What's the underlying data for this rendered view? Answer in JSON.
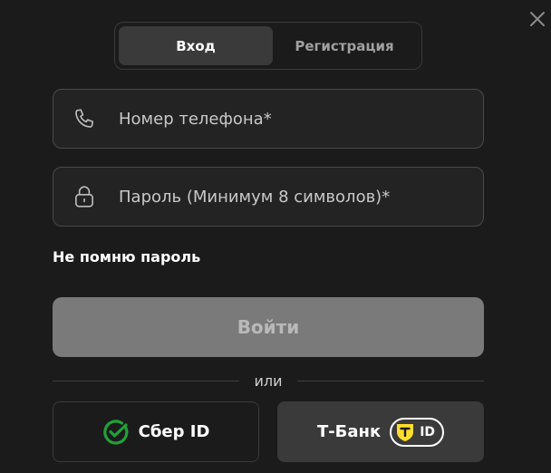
{
  "tabs": [
    {
      "label": "Вход",
      "active": true
    },
    {
      "label": "Регистрация",
      "active": false
    }
  ],
  "phone": {
    "placeholder": "Номер телефона*",
    "value": "",
    "icon": "phone-icon"
  },
  "password": {
    "placeholder": "Пароль (Минимум 8 символов)*",
    "value": "",
    "icon": "lock-icon"
  },
  "forgot_label": "Не помню пароль",
  "submit_label": "Войти",
  "divider_label": "или",
  "sso": {
    "sber_label": "Сбер ID",
    "tbank_label": "Т-Банк",
    "tbank_badge": "ID"
  },
  "colors": {
    "background": "#1b1b1b",
    "submit_disabled": "#7a7a7a",
    "sber_green": "#21a038",
    "tbank_yellow": "#ffdd2d"
  }
}
